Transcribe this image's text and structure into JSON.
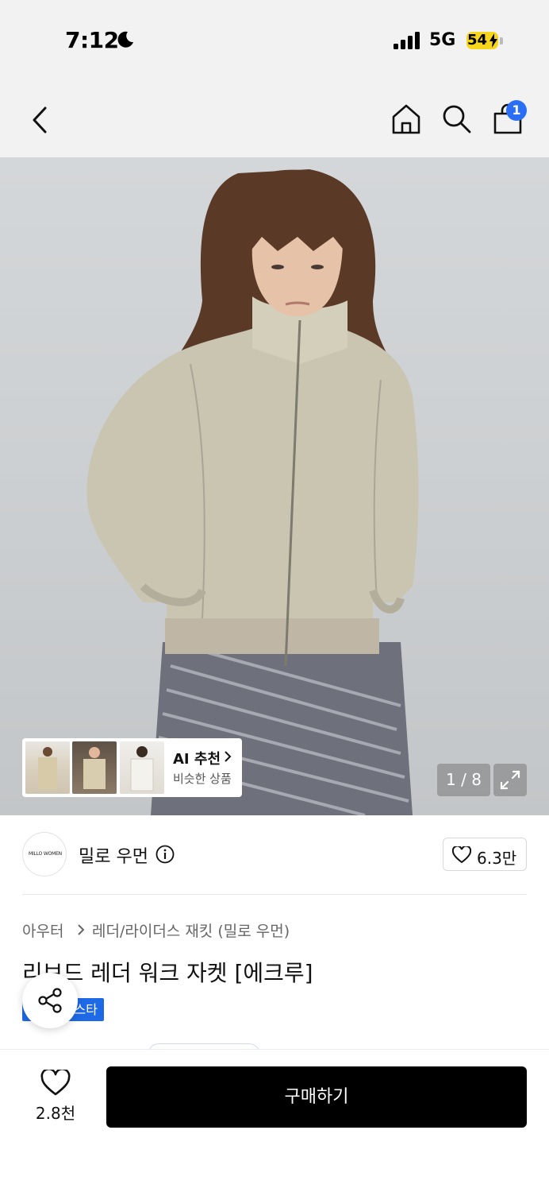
{
  "status_bar": {
    "time": "7:12",
    "network": "5G",
    "battery": "54"
  },
  "nav": {
    "back_icon": "chevron-left-icon",
    "home_icon": "home-icon",
    "search_icon": "search-icon",
    "cart_icon": "bag-icon",
    "cart_count": "1"
  },
  "hero": {
    "ai_recommend": {
      "title": "AI 추천",
      "subtitle": "비슷한 상품"
    },
    "counter": "1 / 8"
  },
  "brand": {
    "logo_text": "MILLO WOMEN",
    "name": "밀로 우먼",
    "likes": "6.3만"
  },
  "breadcrumb": {
    "level1": "아우터",
    "level2": "레더/라이더스 재킷 (밀로 우먼)"
  },
  "product": {
    "title": "리브드 레더 워크 자켓 [에크루]",
    "tag": "스타"
  },
  "bottom": {
    "wish_count": "2.8천",
    "buy_label": "구매하기"
  },
  "colors": {
    "accent": "#2a6ef5",
    "tag": "#1e6ae6",
    "buy_bg": "#000000"
  }
}
